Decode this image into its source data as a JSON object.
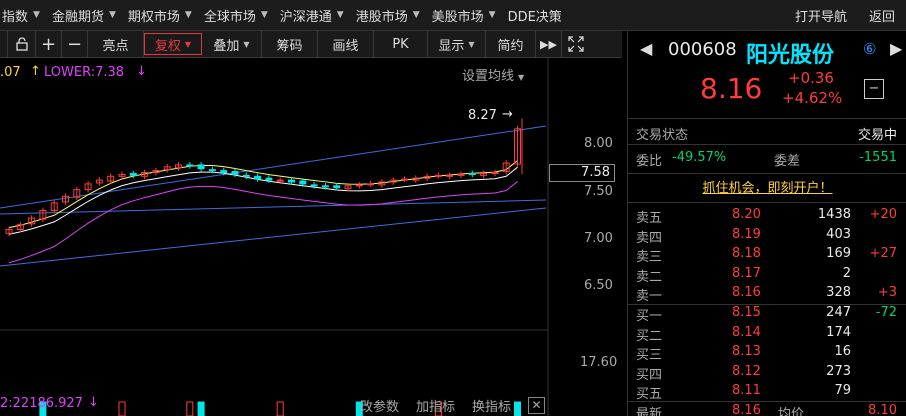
{
  "menu": {
    "items": [
      "指数",
      "金融期货",
      "期权市场",
      "全球市场",
      "沪深港通",
      "港股市场",
      "美股市场",
      "DDE决策"
    ],
    "right_items": [
      "打开导航",
      "返回"
    ]
  },
  "toolbar": {
    "buttons": [
      "亮点",
      "复权",
      "叠加",
      "筹码",
      "画线",
      "PK",
      "显示",
      "简约"
    ]
  },
  "chart": {
    "upper_value": ".07",
    "lower_label": "LOWER:7.38",
    "settings_label": "设置均线",
    "peak_label": "8.27",
    "price_axis": [
      "8.00",
      "7.50",
      "7.00",
      "6.50"
    ],
    "current_price_tag": "7.58",
    "indicator_value": "2:22186.927",
    "indicator_buttons": [
      "改参数",
      "加指标",
      "换指标"
    ],
    "volume_axis": "17.60",
    "colors": {
      "up": "#ff3b3b",
      "down": "#00e5e5",
      "ma1": "#ffffff",
      "ma2": "#ffff66",
      "ma3": "#e040fb",
      "channel": "#3b6fe0"
    }
  },
  "stock": {
    "code": "000608",
    "name": "阳光股份",
    "badge": "⑥",
    "price": "8.16",
    "change": "+0.36",
    "change_pct": "+4.62%",
    "trade_status_label": "交易状态",
    "trade_status_value": "交易中",
    "weibi_label": "委比",
    "weibi_value": "-49.57%",
    "weicha_label": "委差",
    "weicha_value": "-1551",
    "ad_text": "抓住机会，即刻开户！",
    "asks": [
      {
        "label": "卖五",
        "price": "8.20",
        "vol": "1438",
        "delta": "+20"
      },
      {
        "label": "卖四",
        "price": "8.19",
        "vol": "403",
        "delta": ""
      },
      {
        "label": "卖三",
        "price": "8.18",
        "vol": "169",
        "delta": "+27"
      },
      {
        "label": "卖二",
        "price": "8.17",
        "vol": "2",
        "delta": ""
      },
      {
        "label": "卖一",
        "price": "8.16",
        "vol": "328",
        "delta": "+3"
      }
    ],
    "bids": [
      {
        "label": "买一",
        "price": "8.15",
        "vol": "247",
        "delta": "-72"
      },
      {
        "label": "买二",
        "price": "8.14",
        "vol": "174",
        "delta": ""
      },
      {
        "label": "买三",
        "price": "8.13",
        "vol": "16",
        "delta": ""
      },
      {
        "label": "买四",
        "price": "8.12",
        "vol": "273",
        "delta": ""
      },
      {
        "label": "买五",
        "price": "8.11",
        "vol": "79",
        "delta": ""
      }
    ],
    "latest_label": "最新",
    "latest_value": "8.16",
    "avg_label": "均价",
    "avg_value": "8.10"
  }
}
